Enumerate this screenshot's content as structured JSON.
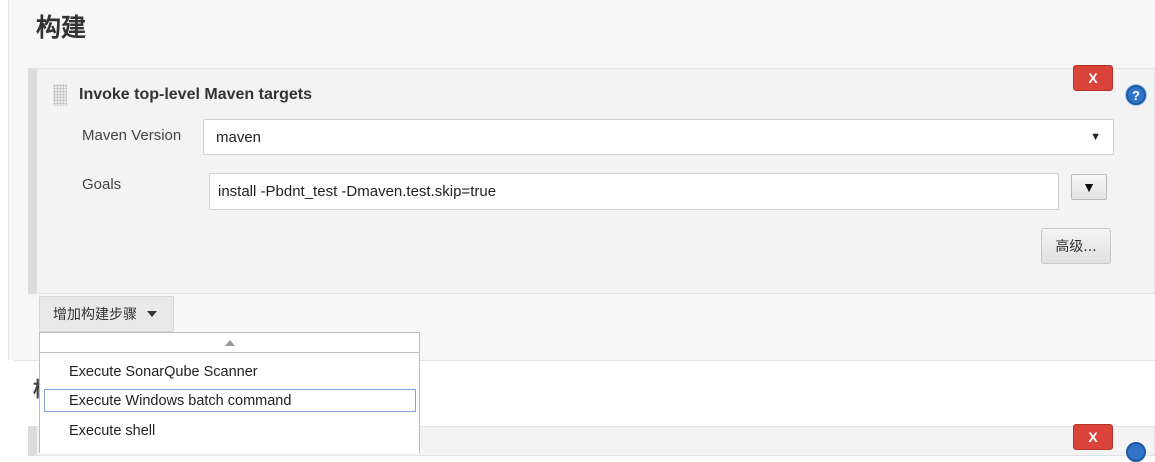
{
  "section": {
    "title": "构建",
    "next_section_peek": "构"
  },
  "step": {
    "title": "Invoke top-level Maven targets",
    "delete_label": "X",
    "help_label": "?",
    "fields": {
      "maven_version_label": "Maven Version",
      "maven_version_value": "maven",
      "goals_label": "Goals",
      "goals_value": "install -Pbdnt_test -Dmaven.test.skip=true"
    },
    "expand_label": "▼",
    "advanced_label": "高级..."
  },
  "add_step": {
    "label": "增加构建步骤"
  },
  "menu": {
    "items": [
      {
        "label": "Execute SonarQube Scanner"
      },
      {
        "label": "Execute Windows batch command",
        "highlighted": true
      },
      {
        "label": "Execute shell"
      }
    ]
  },
  "lower_step": {
    "delete_label": "X"
  },
  "colors": {
    "delete_red": "#d9433a",
    "help_blue": "#2f74c6",
    "menu_highlight": "#7fa8d8"
  }
}
